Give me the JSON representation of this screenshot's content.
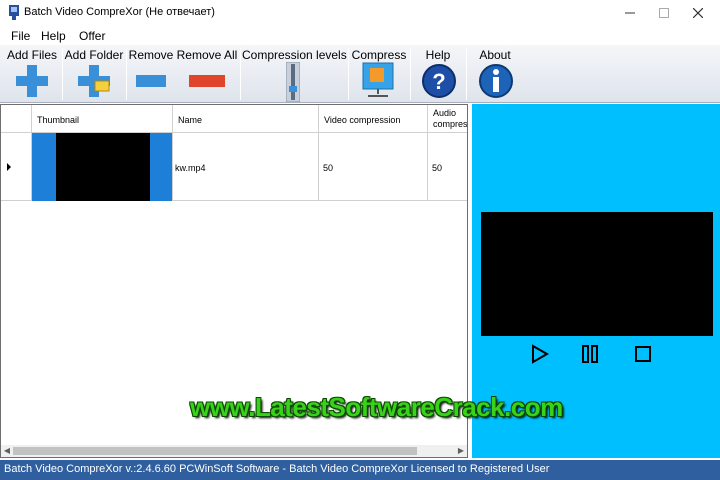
{
  "window": {
    "title": "Batch Video CompreXor (Не отвечает)"
  },
  "menu": [
    "File",
    "Help",
    "Offer"
  ],
  "toolbar": {
    "add_files": "Add Files",
    "add_folder": "Add Folder",
    "remove": "Remove",
    "remove_all": "Remove All",
    "compression_levels": "Compression levels",
    "compress": "Compress",
    "help": "Help",
    "about": "About"
  },
  "grid": {
    "columns": {
      "thumbnail": "Thumbnail",
      "name": "Name",
      "video_compression": "Video compression",
      "audio_compression": "Audio compress"
    },
    "rows": [
      {
        "name": "kw.mp4",
        "video_compression": "50",
        "audio_compression": "50"
      }
    ]
  },
  "watermark": "www.LatestSoftwareCrack.com",
  "status": "Batch Video CompreXor v.:2.4.6.60 PCWinSoft Software - Batch Video CompreXor Licensed to Registered User",
  "colors": {
    "preview_bg": "#00bfff",
    "statusbar_bg": "#2f5f9e",
    "icon_blue": "#3a8fd9"
  }
}
